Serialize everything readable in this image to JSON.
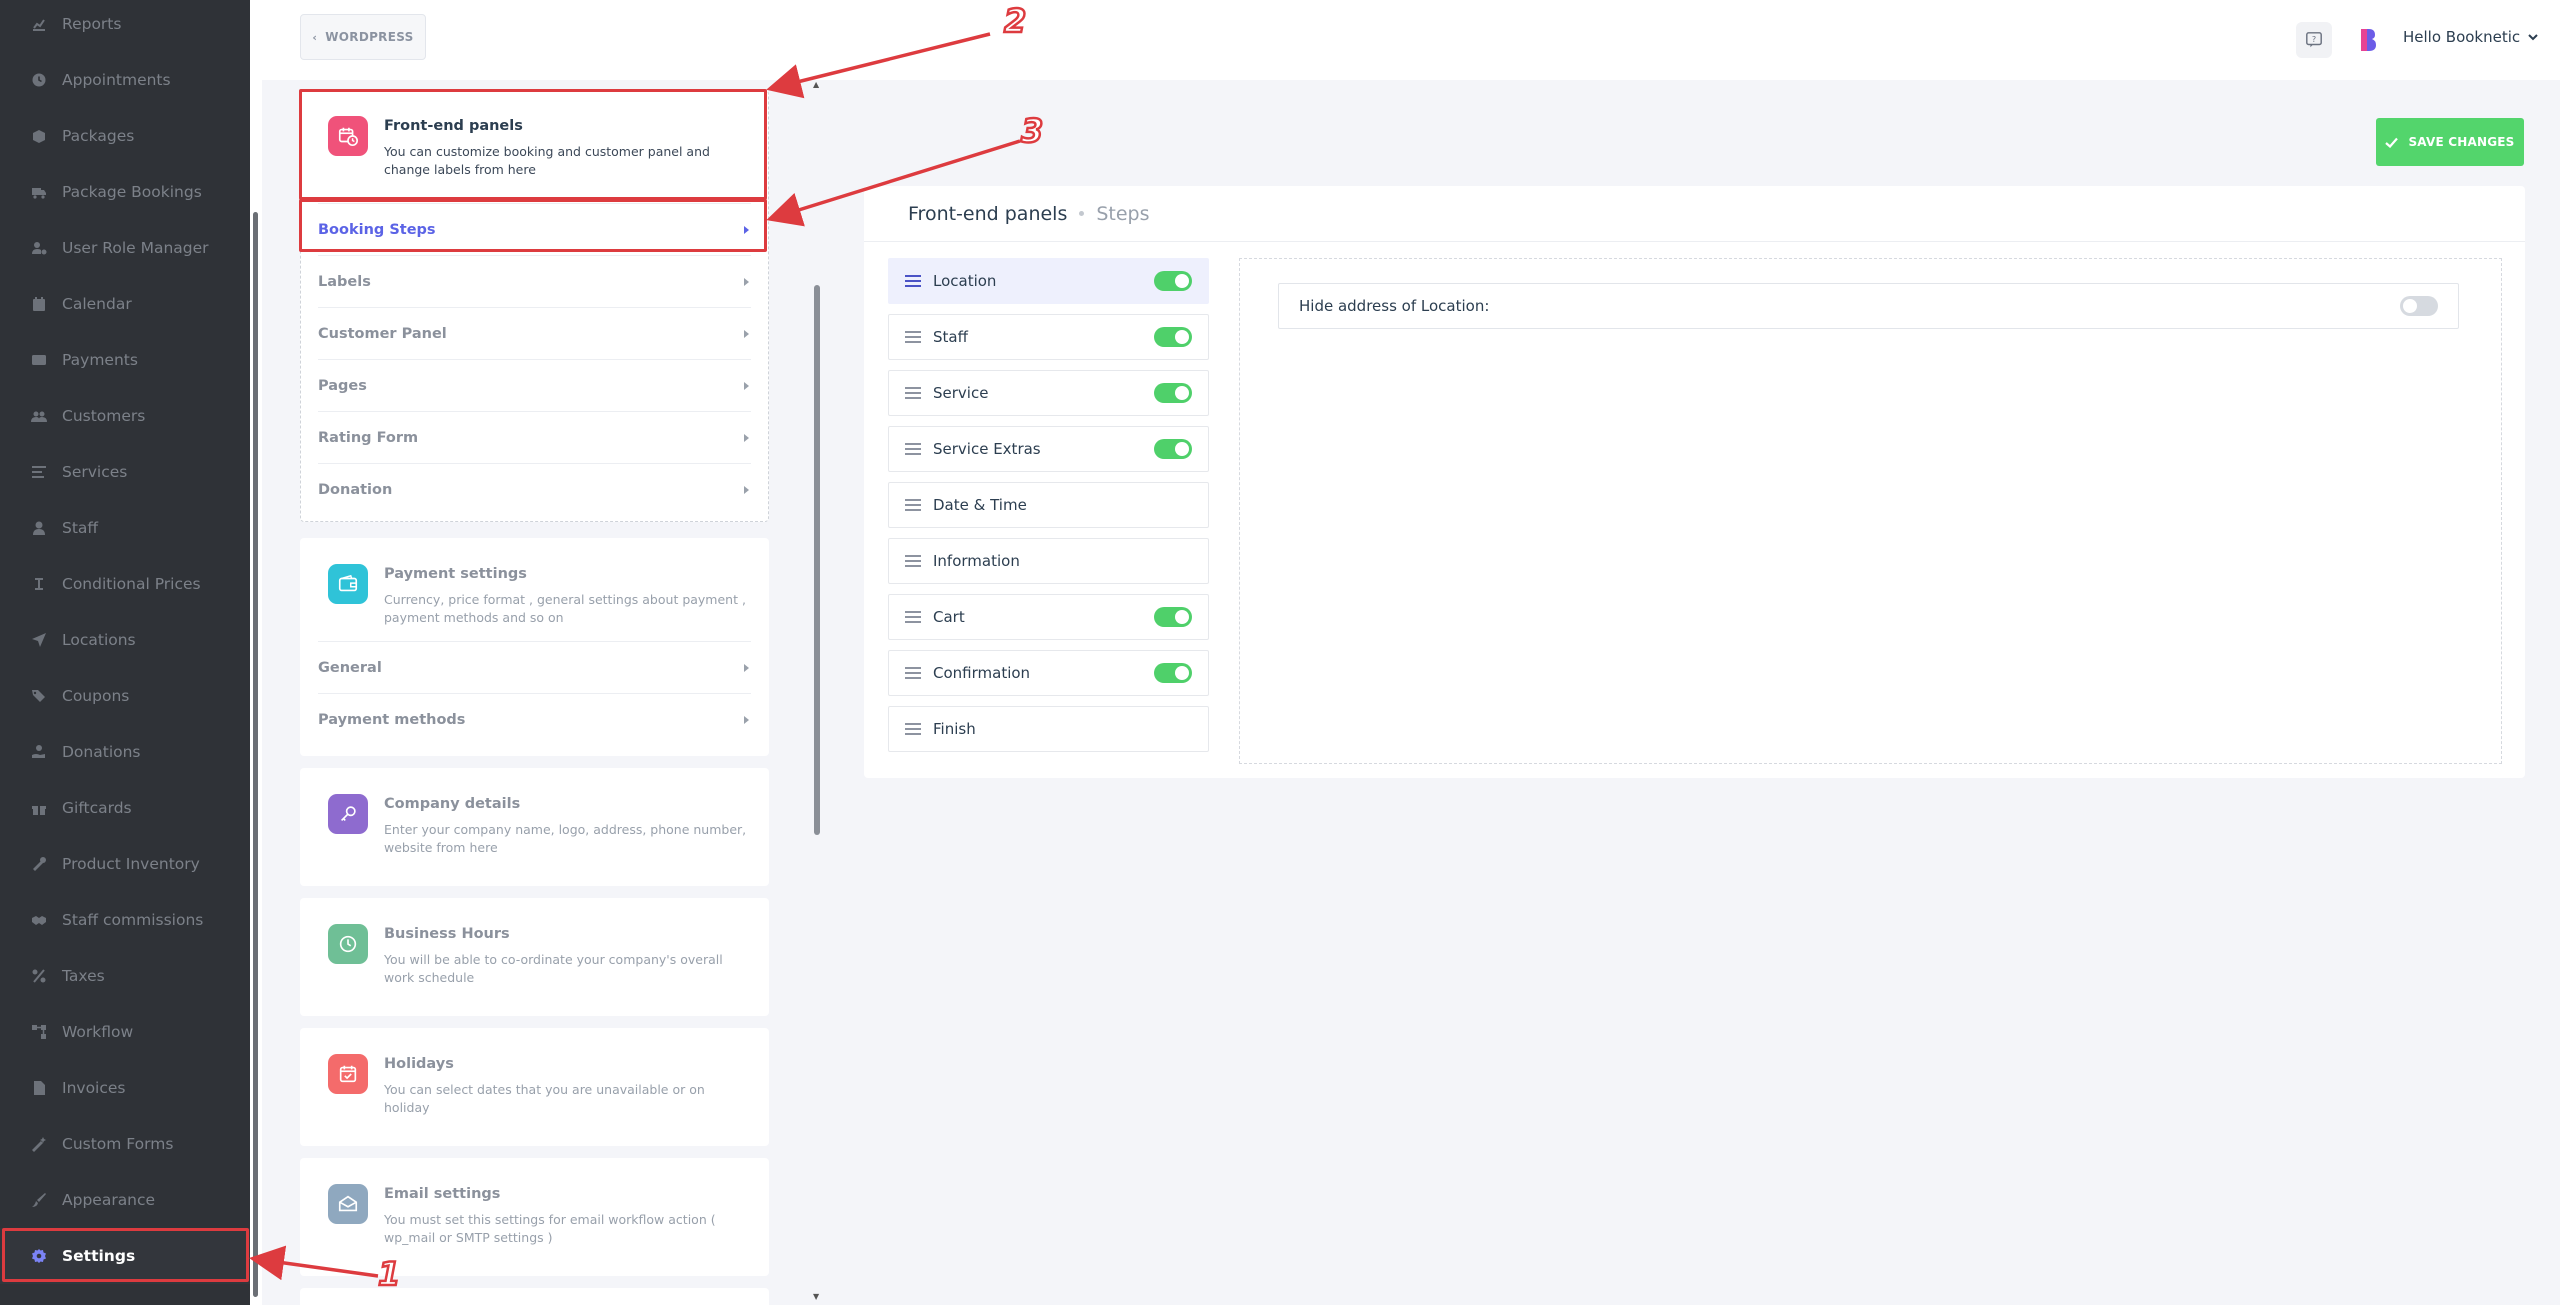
{
  "sidebar": {
    "items": [
      {
        "label": "Reports",
        "icon": "chart-icon"
      },
      {
        "label": "Appointments",
        "icon": "clock-icon"
      },
      {
        "label": "Packages",
        "icon": "box-icon"
      },
      {
        "label": "Package Bookings",
        "icon": "truck-icon"
      },
      {
        "label": "User Role Manager",
        "icon": "user-gear-icon"
      },
      {
        "label": "Calendar",
        "icon": "calendar-icon"
      },
      {
        "label": "Payments",
        "icon": "credit-card-icon"
      },
      {
        "label": "Customers",
        "icon": "users-icon"
      },
      {
        "label": "Services",
        "icon": "list-icon"
      },
      {
        "label": "Staff",
        "icon": "user-icon"
      },
      {
        "label": "Conditional Prices",
        "icon": "cursor-icon"
      },
      {
        "label": "Locations",
        "icon": "location-arrow-icon"
      },
      {
        "label": "Coupons",
        "icon": "tags-icon"
      },
      {
        "label": "Donations",
        "icon": "hand-holding-icon"
      },
      {
        "label": "Giftcards",
        "icon": "gift-icon"
      },
      {
        "label": "Product Inventory",
        "icon": "tools-icon"
      },
      {
        "label": "Staff commissions",
        "icon": "handshake-icon"
      },
      {
        "label": "Taxes",
        "icon": "percent-icon"
      },
      {
        "label": "Workflow",
        "icon": "workflow-icon"
      },
      {
        "label": "Invoices",
        "icon": "file-icon"
      },
      {
        "label": "Custom Forms",
        "icon": "magic-icon"
      },
      {
        "label": "Appearance",
        "icon": "brush-icon"
      },
      {
        "label": "Settings",
        "icon": "cog-icon",
        "active": true
      }
    ]
  },
  "topbar": {
    "wordpress_label": "WORDPRESS",
    "user_label": "Hello Booknetic"
  },
  "settings_cards": {
    "frontend": {
      "title": "Front-end panels",
      "desc": "You can customize booking and customer panel and change labels from here",
      "color": "#f0527a",
      "items": [
        "Booking Steps",
        "Labels",
        "Customer Panel",
        "Pages",
        "Rating Form",
        "Donation"
      ]
    },
    "payment": {
      "title": "Payment settings",
      "desc": "Currency, price format , general settings about payment , payment methods and so on",
      "color": "#2fc3d8",
      "items": [
        "General",
        "Payment methods"
      ]
    },
    "company": {
      "title": "Company details",
      "desc": "Enter your company name, logo, address, phone number, website from here",
      "color": "#8e6bcf"
    },
    "hours": {
      "title": "Business Hours",
      "desc": "You will be able to co-ordinate your company's overall work schedule",
      "color": "#6fbf96"
    },
    "holidays": {
      "title": "Holidays",
      "desc": "You can select dates that you are unavailable or on holiday",
      "color": "#f46b6b"
    },
    "email": {
      "title": "Email settings",
      "desc": "You must set this settings for email workflow action ( wp_mail or SMTP settings )",
      "color": "#8fa8bf"
    }
  },
  "annotations": [
    "1",
    "2",
    "3"
  ],
  "main": {
    "save_label": "SAVE CHANGES",
    "title": "Front-end panels",
    "subtitle": "Steps",
    "steps": [
      {
        "label": "Location",
        "toggle": true,
        "active": true
      },
      {
        "label": "Staff",
        "toggle": true
      },
      {
        "label": "Service",
        "toggle": true
      },
      {
        "label": "Service Extras",
        "toggle": true
      },
      {
        "label": "Date & Time",
        "toggle": null
      },
      {
        "label": "Information",
        "toggle": null
      },
      {
        "label": "Cart",
        "toggle": true
      },
      {
        "label": "Confirmation",
        "toggle": true
      },
      {
        "label": "Finish",
        "toggle": null
      }
    ],
    "option_label": "Hide address of Location:",
    "option_enabled": false
  },
  "colors": {
    "accent": "#5b63e6",
    "success": "#53d56c",
    "annotation": "#dd3b3f"
  }
}
